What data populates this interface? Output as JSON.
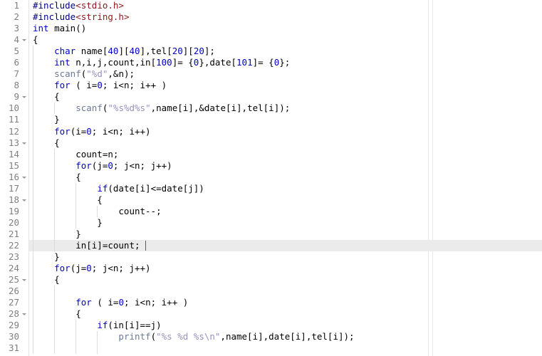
{
  "editor": {
    "app": "code-editor",
    "language": "C",
    "font_size_px": 12.5,
    "line_height_px": 16,
    "current_line": 22,
    "cursor": {
      "line": 22,
      "column": 23
    },
    "colors": {
      "background": "#ffffff",
      "gutter_background": "#ffffff",
      "gutter_separator": "#e4e4e4",
      "line_number": "#808080",
      "current_line_highlight": "#ebebeb",
      "indent_guide": "#dcdcdc",
      "ruler": "#e8e8e8",
      "keyword": "#0000c8",
      "preprocessor": "#000080",
      "include_header": "#8b1a1a",
      "number": "#0000c8",
      "string": "#9a8fc0",
      "function": "#6a7a96",
      "plain_text": "#000000",
      "caret": "#5a5a5a"
    },
    "rulers": [
      601,
      607
    ]
  },
  "lines": [
    {
      "n": "1",
      "fold": false,
      "guides": 0,
      "indent": 0,
      "tokens": [
        {
          "t": "#include",
          "c": "pp"
        },
        {
          "t": "<stdio.h>",
          "c": "inc"
        }
      ]
    },
    {
      "n": "2",
      "fold": false,
      "guides": 0,
      "indent": 0,
      "tokens": [
        {
          "t": "#include",
          "c": "pp"
        },
        {
          "t": "<string.h>",
          "c": "inc"
        }
      ]
    },
    {
      "n": "3",
      "fold": false,
      "guides": 0,
      "indent": 0,
      "tokens": [
        {
          "t": "int",
          "c": "kw"
        },
        {
          "t": " main()",
          "c": "plain"
        }
      ]
    },
    {
      "n": "4",
      "fold": true,
      "guides": 0,
      "indent": 0,
      "tokens": [
        {
          "t": "{",
          "c": "plain"
        }
      ]
    },
    {
      "n": "5",
      "fold": false,
      "guides": 1,
      "indent": 1,
      "tokens": [
        {
          "t": "    ",
          "c": "plain"
        },
        {
          "t": "char",
          "c": "kw"
        },
        {
          "t": " name[",
          "c": "plain"
        },
        {
          "t": "40",
          "c": "num"
        },
        {
          "t": "][",
          "c": "plain"
        },
        {
          "t": "40",
          "c": "num"
        },
        {
          "t": "],tel[",
          "c": "plain"
        },
        {
          "t": "20",
          "c": "num"
        },
        {
          "t": "][",
          "c": "plain"
        },
        {
          "t": "20",
          "c": "num"
        },
        {
          "t": "];",
          "c": "plain"
        }
      ]
    },
    {
      "n": "6",
      "fold": false,
      "guides": 1,
      "indent": 1,
      "tokens": [
        {
          "t": "    ",
          "c": "plain"
        },
        {
          "t": "int",
          "c": "kw"
        },
        {
          "t": " n,i,j,count,in[",
          "c": "plain"
        },
        {
          "t": "100",
          "c": "num"
        },
        {
          "t": "]= {",
          "c": "plain"
        },
        {
          "t": "0",
          "c": "num"
        },
        {
          "t": "},date[",
          "c": "plain"
        },
        {
          "t": "101",
          "c": "num"
        },
        {
          "t": "]= {",
          "c": "plain"
        },
        {
          "t": "0",
          "c": "num"
        },
        {
          "t": "};",
          "c": "plain"
        }
      ]
    },
    {
      "n": "7",
      "fold": false,
      "guides": 1,
      "indent": 1,
      "tokens": [
        {
          "t": "    ",
          "c": "plain"
        },
        {
          "t": "scanf",
          "c": "fn"
        },
        {
          "t": "(",
          "c": "plain"
        },
        {
          "t": "\"%d\"",
          "c": "str"
        },
        {
          "t": ",&n);",
          "c": "plain"
        }
      ]
    },
    {
      "n": "8",
      "fold": false,
      "guides": 1,
      "indent": 1,
      "tokens": [
        {
          "t": "    ",
          "c": "plain"
        },
        {
          "t": "for",
          "c": "kw"
        },
        {
          "t": " ( i=",
          "c": "plain"
        },
        {
          "t": "0",
          "c": "num"
        },
        {
          "t": "; i<n; i++ )",
          "c": "plain"
        }
      ]
    },
    {
      "n": "9",
      "fold": true,
      "guides": 1,
      "indent": 1,
      "tokens": [
        {
          "t": "    {",
          "c": "plain"
        }
      ]
    },
    {
      "n": "10",
      "fold": false,
      "guides": 2,
      "indent": 2,
      "tokens": [
        {
          "t": "        ",
          "c": "plain"
        },
        {
          "t": "scanf",
          "c": "fn"
        },
        {
          "t": "(",
          "c": "plain"
        },
        {
          "t": "\"%s%d%s\"",
          "c": "str"
        },
        {
          "t": ",name[i],&date[i],tel[i]);",
          "c": "plain"
        }
      ]
    },
    {
      "n": "11",
      "fold": false,
      "guides": 1,
      "indent": 1,
      "tokens": [
        {
          "t": "    }",
          "c": "plain"
        }
      ]
    },
    {
      "n": "12",
      "fold": false,
      "guides": 1,
      "indent": 1,
      "tokens": [
        {
          "t": "    ",
          "c": "plain"
        },
        {
          "t": "for",
          "c": "kw"
        },
        {
          "t": "(i=",
          "c": "plain"
        },
        {
          "t": "0",
          "c": "num"
        },
        {
          "t": "; i<n; i++)",
          "c": "plain"
        }
      ]
    },
    {
      "n": "13",
      "fold": true,
      "guides": 1,
      "indent": 1,
      "tokens": [
        {
          "t": "    {",
          "c": "plain"
        }
      ]
    },
    {
      "n": "14",
      "fold": false,
      "guides": 2,
      "indent": 2,
      "tokens": [
        {
          "t": "        count=n;",
          "c": "plain"
        }
      ]
    },
    {
      "n": "15",
      "fold": false,
      "guides": 2,
      "indent": 2,
      "tokens": [
        {
          "t": "        ",
          "c": "plain"
        },
        {
          "t": "for",
          "c": "kw"
        },
        {
          "t": "(j=",
          "c": "plain"
        },
        {
          "t": "0",
          "c": "num"
        },
        {
          "t": "; j<n; j++)",
          "c": "plain"
        }
      ]
    },
    {
      "n": "16",
      "fold": true,
      "guides": 2,
      "indent": 2,
      "tokens": [
        {
          "t": "        {",
          "c": "plain"
        }
      ]
    },
    {
      "n": "17",
      "fold": false,
      "guides": 3,
      "indent": 3,
      "tokens": [
        {
          "t": "            ",
          "c": "plain"
        },
        {
          "t": "if",
          "c": "kw"
        },
        {
          "t": "(date[i]<=date[j])",
          "c": "plain"
        }
      ]
    },
    {
      "n": "18",
      "fold": true,
      "guides": 3,
      "indent": 3,
      "tokens": [
        {
          "t": "            {",
          "c": "plain"
        }
      ]
    },
    {
      "n": "19",
      "fold": false,
      "guides": 4,
      "indent": 4,
      "tokens": [
        {
          "t": "                count--;",
          "c": "plain"
        }
      ]
    },
    {
      "n": "20",
      "fold": false,
      "guides": 3,
      "indent": 3,
      "tokens": [
        {
          "t": "            }",
          "c": "plain"
        }
      ]
    },
    {
      "n": "21",
      "fold": false,
      "guides": 2,
      "indent": 2,
      "tokens": [
        {
          "t": "        }",
          "c": "plain"
        }
      ]
    },
    {
      "n": "22",
      "fold": false,
      "guides": 2,
      "indent": 2,
      "current": true,
      "caret_col": 21,
      "tokens": [
        {
          "t": "        in[i]=count;",
          "c": "plain"
        }
      ]
    },
    {
      "n": "23",
      "fold": false,
      "guides": 1,
      "indent": 1,
      "tokens": [
        {
          "t": "    }",
          "c": "plain"
        }
      ]
    },
    {
      "n": "24",
      "fold": false,
      "guides": 1,
      "indent": 1,
      "tokens": [
        {
          "t": "    ",
          "c": "plain"
        },
        {
          "t": "for",
          "c": "kw"
        },
        {
          "t": "(j=",
          "c": "plain"
        },
        {
          "t": "0",
          "c": "num"
        },
        {
          "t": "; j<n; j++)",
          "c": "plain"
        }
      ]
    },
    {
      "n": "25",
      "fold": true,
      "guides": 1,
      "indent": 1,
      "tokens": [
        {
          "t": "    {",
          "c": "plain"
        }
      ]
    },
    {
      "n": "26",
      "fold": false,
      "guides": 2,
      "indent": 2,
      "tokens": [
        {
          "t": "",
          "c": "plain"
        }
      ]
    },
    {
      "n": "27",
      "fold": false,
      "guides": 2,
      "indent": 2,
      "tokens": [
        {
          "t": "        ",
          "c": "plain"
        },
        {
          "t": "for",
          "c": "kw"
        },
        {
          "t": " ( i=",
          "c": "plain"
        },
        {
          "t": "0",
          "c": "num"
        },
        {
          "t": "; i<n; i++ )",
          "c": "plain"
        }
      ]
    },
    {
      "n": "28",
      "fold": true,
      "guides": 2,
      "indent": 2,
      "tokens": [
        {
          "t": "        {",
          "c": "plain"
        }
      ]
    },
    {
      "n": "29",
      "fold": false,
      "guides": 3,
      "indent": 3,
      "tokens": [
        {
          "t": "            ",
          "c": "plain"
        },
        {
          "t": "if",
          "c": "kw"
        },
        {
          "t": "(in[i]==j)",
          "c": "plain"
        }
      ]
    },
    {
      "n": "30",
      "fold": false,
      "guides": 4,
      "indent": 4,
      "tokens": [
        {
          "t": "                ",
          "c": "plain"
        },
        {
          "t": "printf",
          "c": "fn"
        },
        {
          "t": "(",
          "c": "plain"
        },
        {
          "t": "\"%s %d %s\\n\"",
          "c": "str"
        },
        {
          "t": ",name[i],date[i],tel[i]);",
          "c": "plain"
        }
      ]
    },
    {
      "n": "31",
      "fold": false,
      "guides": 4,
      "indent": 4,
      "tokens": [
        {
          "t": "",
          "c": "plain"
        }
      ]
    }
  ]
}
